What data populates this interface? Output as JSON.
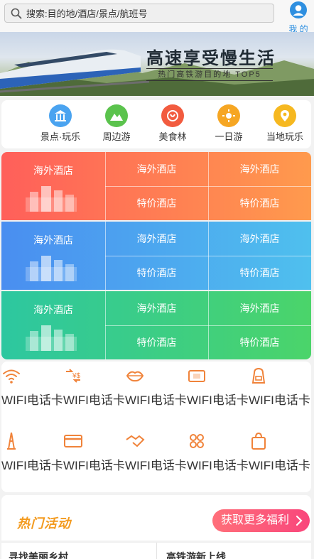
{
  "search": {
    "placeholder": "搜索:目的地/酒店/景点/航班号"
  },
  "profile": {
    "label": "我 的"
  },
  "banner": {
    "title": "高速享受慢生活",
    "subtitle": "热门高铁游目的地 TOP5"
  },
  "categories": [
    {
      "label": "景点·玩乐",
      "icon": "temple-icon",
      "color": "#4aa3f0"
    },
    {
      "label": "周边游",
      "icon": "mountain-icon",
      "color": "#5bc34d"
    },
    {
      "label": "美食林",
      "icon": "food-icon",
      "color": "#f25b3f"
    },
    {
      "label": "一日游",
      "icon": "sun-icon",
      "color": "#f6a623"
    },
    {
      "label": "当地玩乐",
      "icon": "location-icon",
      "color": "#f6b820"
    }
  ],
  "hotel_blocks": [
    {
      "main": "海外酒店",
      "top_a": "海外酒店",
      "top_b": "海外酒店",
      "bottom_a": "特价酒店",
      "bottom_b": "特价酒店"
    },
    {
      "main": "海外酒店",
      "top_a": "海外酒店",
      "top_b": "海外酒店",
      "bottom_a": "特价酒店",
      "bottom_b": "特价酒店"
    },
    {
      "main": "海外酒店",
      "top_a": "海外酒店",
      "top_b": "海外酒店",
      "bottom_a": "特价酒店",
      "bottom_b": "特价酒店"
    }
  ],
  "services": [
    {
      "label": "WIFI电话卡",
      "icon": "wifi-icon"
    },
    {
      "label": "WIFI电话卡",
      "icon": "currency-exchange-icon"
    },
    {
      "label": "WIFI电话卡",
      "icon": "lips-icon"
    },
    {
      "label": "WIFI电话卡",
      "icon": "ticket-icon"
    },
    {
      "label": "WIFI电话卡",
      "icon": "backpack-icon"
    },
    {
      "label": "WIFI电话卡",
      "icon": "eiffel-tower-icon"
    },
    {
      "label": "WIFI电话卡",
      "icon": "credit-card-icon"
    },
    {
      "label": "WIFI电话卡",
      "icon": "handshake-icon"
    },
    {
      "label": "WIFI电话卡",
      "icon": "clover-icon"
    },
    {
      "label": "WIFI电话卡",
      "icon": "shopping-bag-icon"
    }
  ],
  "hot": {
    "logo": "热门活动",
    "more_label": "获取更多福利"
  },
  "bottom": {
    "left": "寻找美丽乡村",
    "right": "高铁游新上线"
  },
  "colors": {
    "accent_orange": "#f0833a",
    "link_blue": "#2a8de0"
  }
}
